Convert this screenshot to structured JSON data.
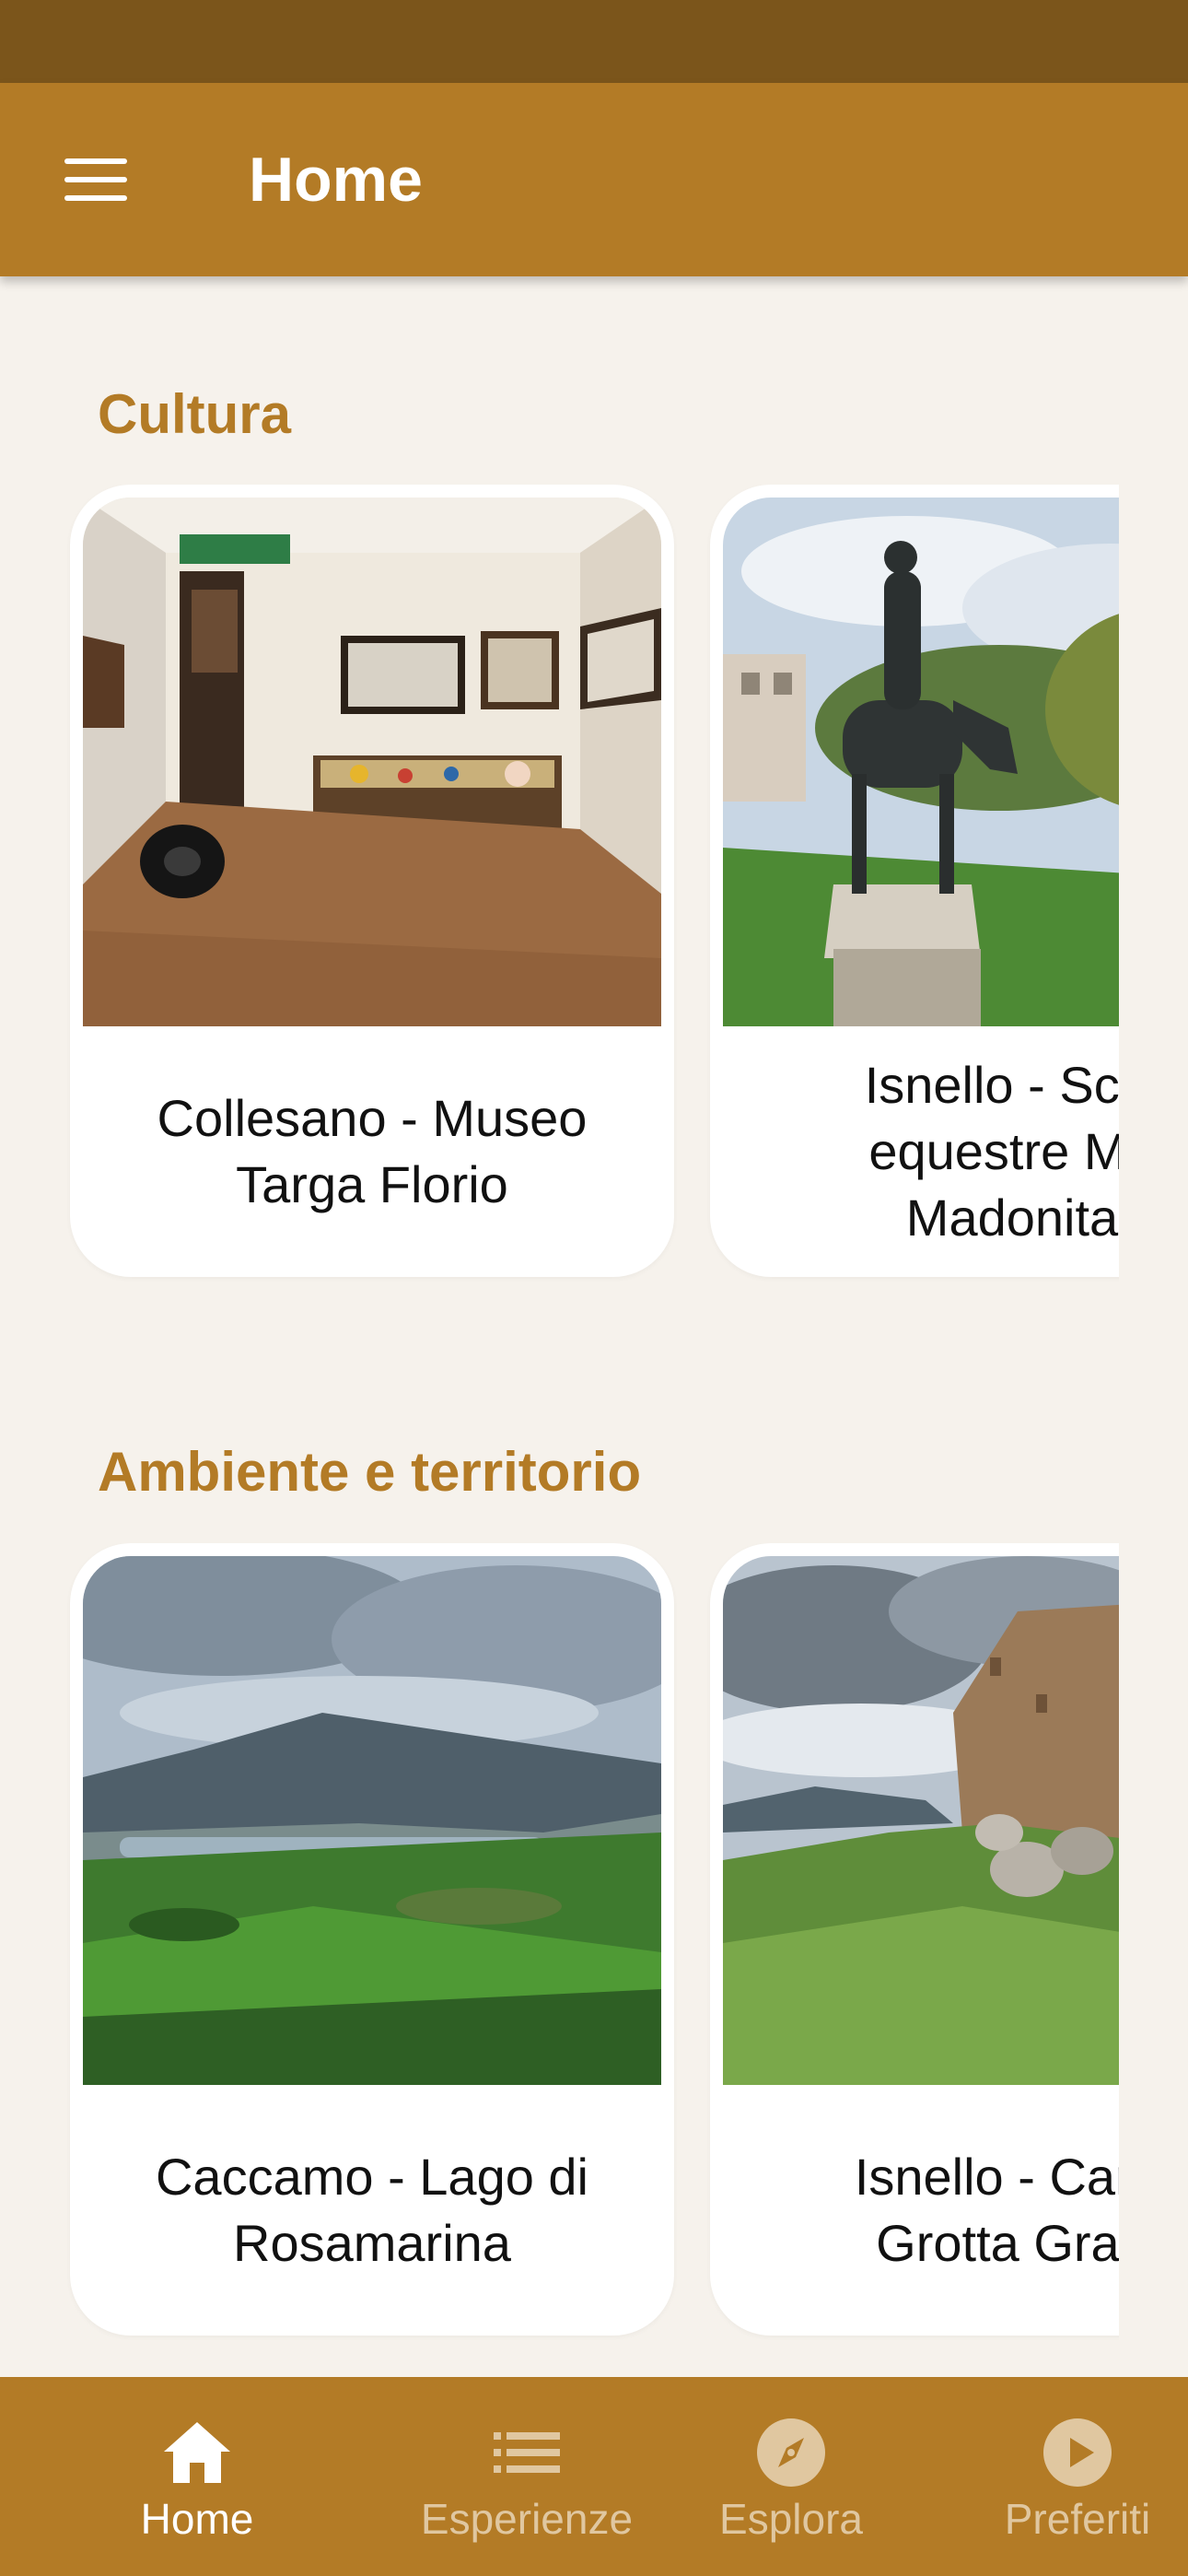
{
  "app_bar": {
    "title": "Home",
    "menu_icon": "hamburger-menu-icon"
  },
  "theme": {
    "primary": "#b37b26",
    "status_bar": "#7b551b",
    "background": "#f6f2ec",
    "section_title": "#b37b26"
  },
  "sections": [
    {
      "title": "Cultura",
      "cards": [
        {
          "caption": "Collesano - Museo\nTarga Florio",
          "image": "museum-interior-photo"
        },
        {
          "caption": "Isnello - Scul\nequestre Ma\nMadonita",
          "image": "equestrian-statue-photo"
        }
      ]
    },
    {
      "title": "Ambiente e territorio",
      "cards": [
        {
          "caption": "Caccamo - Lago di\nRosamarina",
          "image": "lake-valley-landscape-photo"
        },
        {
          "caption": "Isnello - Cany\nGrotta Gran",
          "image": "castle-ruins-hillside-photo"
        }
      ]
    }
  ],
  "bottom_nav": [
    {
      "label": "Home",
      "icon": "home-icon",
      "active": true
    },
    {
      "label": "Esperienze",
      "icon": "list-icon",
      "active": false
    },
    {
      "label": "Esplora",
      "icon": "compass-icon",
      "active": false
    },
    {
      "label": "Preferiti",
      "icon": "play-circle-icon",
      "active": false
    }
  ]
}
